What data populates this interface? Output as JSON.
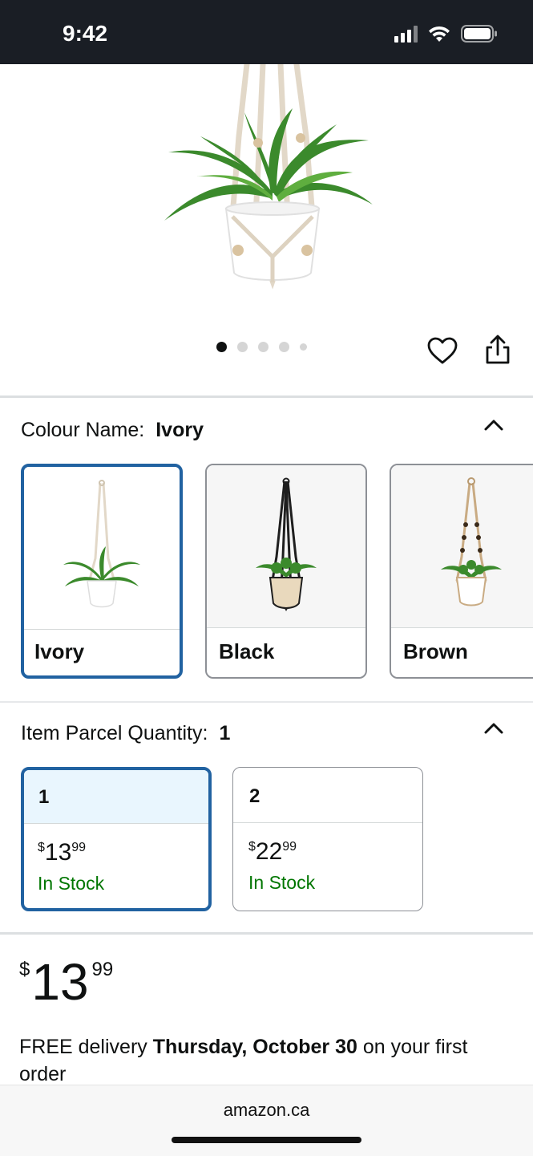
{
  "status_bar": {
    "time": "9:42"
  },
  "hero": {
    "pager_count": 5,
    "pager_active": 1
  },
  "colour": {
    "label": "Colour Name:",
    "selected": "Ivory",
    "options": [
      {
        "name": "Ivory",
        "selected": true
      },
      {
        "name": "Black",
        "selected": false
      },
      {
        "name": "Brown",
        "selected": false
      }
    ]
  },
  "quantity": {
    "label": "Item Parcel Quantity:",
    "selected": "1",
    "options": [
      {
        "qty": "1",
        "currency": "$",
        "dollars": "13",
        "cents": "99",
        "stock": "In Stock",
        "selected": true
      },
      {
        "qty": "2",
        "currency": "$",
        "dollars": "22",
        "cents": "99",
        "stock": "In Stock",
        "selected": false
      }
    ]
  },
  "price": {
    "currency": "$",
    "dollars": "13",
    "cents": "99"
  },
  "delivery": {
    "prefix": "FREE delivery ",
    "date": "Thursday, October 30",
    "suffix": " on your first order"
  },
  "browser": {
    "url": "amazon.ca"
  },
  "colors": {
    "selected_border": "#2162a1",
    "stock_green": "#007600",
    "status_bar_bg": "#1a1e25"
  }
}
